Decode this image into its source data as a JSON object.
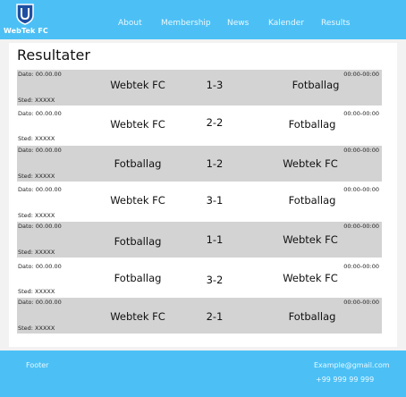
{
  "header": {
    "brand": "WebTek FC",
    "nav": [
      "About",
      "Membership",
      "News",
      "Kalender",
      "Results"
    ]
  },
  "main": {
    "title": "Resultater",
    "results": [
      {
        "date": "Dato: 00.00.00",
        "time": "00:00-00:00",
        "place": "Sted: XXXXX",
        "home": "Webtek FC",
        "score": "1-3",
        "away": "Fotballag"
      },
      {
        "date": "Dato: 00.00.00",
        "time": "00:00-00:00",
        "place": "Sted: XXXXX",
        "home": "Webtek FC",
        "score": "2-2",
        "away": "Fotballag"
      },
      {
        "date": "Dato: 00.00.00",
        "time": "00:00-00:00",
        "place": "Sted: XXXXX",
        "home": "Fotballag",
        "score": "1-2",
        "away": "Webtek FC"
      },
      {
        "date": "Dato: 00.00.00",
        "time": "00:00-00:00",
        "place": "Sted: XXXXX",
        "home": "Webtek FC",
        "score": "3-1",
        "away": "Fotballag"
      },
      {
        "date": "Dato: 00.00.00",
        "time": "00:00-00:00",
        "place": "Sted: XXXXX",
        "home": "Fotballag",
        "score": "1-1",
        "away": "Webtek FC"
      },
      {
        "date": "Dato: 00.00.00",
        "time": "00:00-00:00",
        "place": "Sted: XXXXX",
        "home": "Fotballag",
        "score": "3-2",
        "away": "Webtek FC"
      },
      {
        "date": "Dato: 00.00.00",
        "time": "00:00-00:00",
        "place": "Sted: XXXXX",
        "home": "Webtek FC",
        "score": "2-1",
        "away": "Fotballag"
      }
    ]
  },
  "footer": {
    "label": "Footer",
    "email": "Example@gmail.com",
    "phone": "+99 999 99 999"
  },
  "colors": {
    "accent": "#4cc0f5",
    "row_shade": "#d3d3d3",
    "logo": "#1f4fa0"
  }
}
